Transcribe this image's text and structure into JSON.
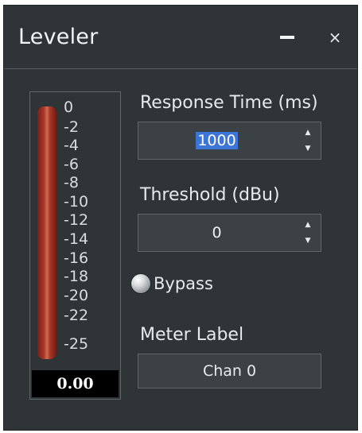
{
  "window": {
    "title": "Leveler",
    "minimize_icon": "minimize-icon",
    "close_glyph": "×"
  },
  "meter": {
    "ticks": [
      "0",
      "-2",
      "-4",
      "-6",
      "-8",
      "-10",
      "-12",
      "-14",
      "-16",
      "-18",
      "-20",
      "-22",
      "-25"
    ],
    "value": "0.00",
    "bar_color": "#a8392b"
  },
  "response_time": {
    "label": "Response Time (ms)",
    "value": "1000"
  },
  "threshold": {
    "label": "Threshold (dBu)",
    "value": "0"
  },
  "bypass": {
    "label": "Bypass"
  },
  "meter_label": {
    "label": "Meter Label",
    "value": "Chan 0"
  },
  "spin_arrows": {
    "up": "▲",
    "down": "▼"
  },
  "colors": {
    "panel_bg": "#2f3437",
    "field_bg": "#3b4145",
    "selection": "#3d75d6"
  }
}
